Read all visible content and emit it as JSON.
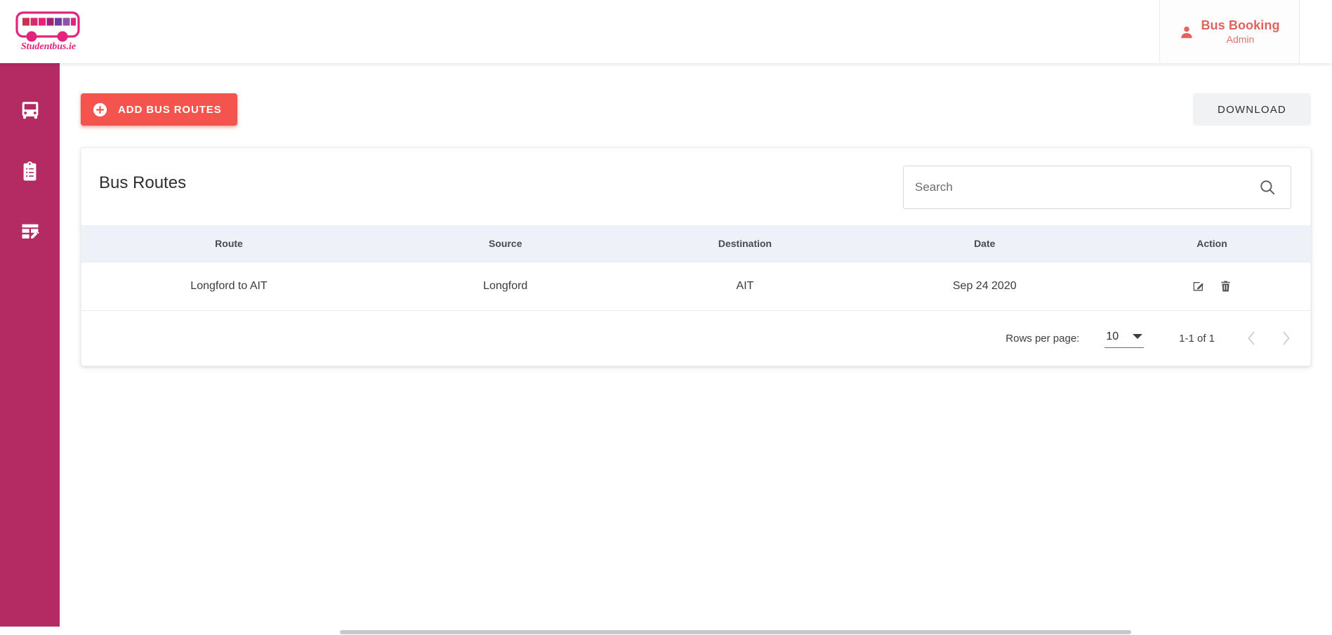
{
  "brand": {
    "logo_name": "bus-logo",
    "logo_text": "Studentbus.ie",
    "logo_colors": [
      "#c9314f",
      "#d42a6e",
      "#ec1e79",
      "#a42178",
      "#6e3f9e",
      "#8e54a8",
      "#e3247d"
    ],
    "accent_pink": "#e3247d",
    "sidebar_color": "#b42b63",
    "primary_button_color": "#f4544d"
  },
  "header": {
    "user_name": "Bus Booking",
    "user_role": "Admin",
    "person_icon": "person-icon"
  },
  "sidebar": {
    "items": [
      {
        "name": "bus",
        "icon": "bus-icon",
        "label": "Bus"
      },
      {
        "name": "bookings",
        "icon": "clipboard-list-icon",
        "label": "Bookings"
      },
      {
        "name": "routes",
        "icon": "table-edit-icon",
        "label": "Routes"
      }
    ]
  },
  "toolbar": {
    "add_label": "ADD BUS ROUTES",
    "add_icon": "plus-circle-icon",
    "download_label": "DOWNLOAD"
  },
  "card": {
    "title": "Bus Routes",
    "search": {
      "placeholder": "Search",
      "value": "",
      "icon": "search-icon"
    }
  },
  "table": {
    "columns": [
      "Route",
      "Source",
      "Destination",
      "Date",
      "Action"
    ],
    "rows": [
      {
        "route": "Longford to AIT",
        "source": "Longford",
        "destination": "AIT",
        "date": "Sep 24 2020",
        "edit_icon": "edit-icon",
        "delete_icon": "trash-icon"
      }
    ]
  },
  "pagination": {
    "rows_per_page_label": "Rows per page:",
    "rows_per_page_value": "10",
    "range_label": "1-1 of 1",
    "prev_icon": "chevron-left-icon",
    "next_icon": "chevron-right-icon"
  }
}
